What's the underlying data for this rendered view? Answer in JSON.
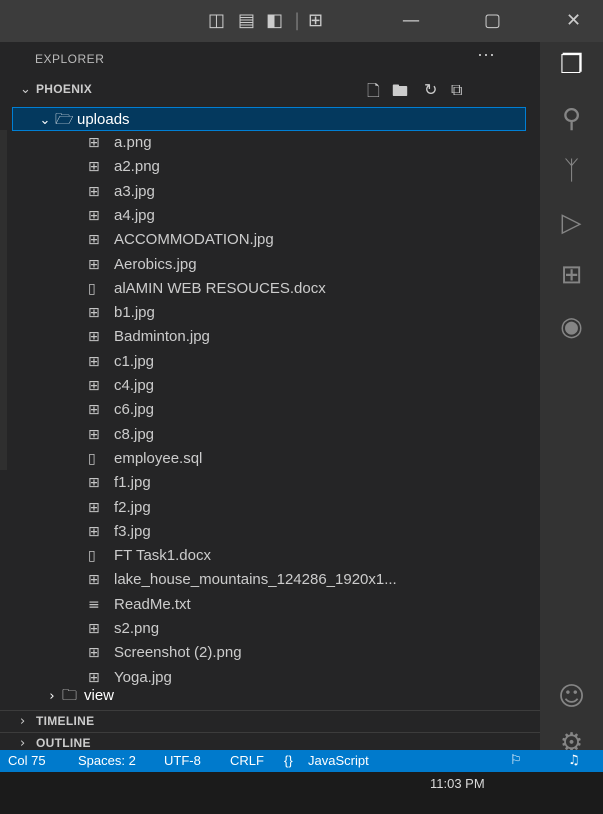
{
  "title_bar": {
    "layout_icons": [
      "▯▯",
      "▭",
      "▮▯",
      "⊞"
    ],
    "minimize": "—",
    "restore": "▢",
    "close": "✕"
  },
  "explorer": {
    "header": "EXPLORER",
    "more": "···",
    "project": "PHOENIX",
    "actions": [
      "new-file-icon",
      "new-folder-icon",
      "refresh-icon",
      "collapse-all-icon"
    ]
  },
  "tree": {
    "uploads": "uploads",
    "files": [
      {
        "name": "a.png",
        "icon": "image-file-icon"
      },
      {
        "name": "a2.png",
        "icon": "image-file-icon"
      },
      {
        "name": "a3.jpg",
        "icon": "image-file-icon"
      },
      {
        "name": "a4.jpg",
        "icon": "image-file-icon"
      },
      {
        "name": "ACCOMMODATION.jpg",
        "icon": "image-file-icon"
      },
      {
        "name": "Aerobics.jpg",
        "icon": "image-file-icon"
      },
      {
        "name": "alAMIN WEB RESOUCES.docx",
        "icon": "file-icon"
      },
      {
        "name": "b1.jpg",
        "icon": "image-file-icon"
      },
      {
        "name": "Badminton.jpg",
        "icon": "image-file-icon"
      },
      {
        "name": "c1.jpg",
        "icon": "image-file-icon"
      },
      {
        "name": "c4.jpg",
        "icon": "image-file-icon"
      },
      {
        "name": "c6.jpg",
        "icon": "image-file-icon"
      },
      {
        "name": "c8.jpg",
        "icon": "image-file-icon"
      },
      {
        "name": "employee.sql",
        "icon": "file-icon"
      },
      {
        "name": "f1.jpg",
        "icon": "image-file-icon"
      },
      {
        "name": "f2.jpg",
        "icon": "image-file-icon"
      },
      {
        "name": "f3.jpg",
        "icon": "image-file-icon"
      },
      {
        "name": "FT Task1.docx",
        "icon": "file-icon"
      },
      {
        "name": "lake_house_mountains_124286_1920x1...",
        "icon": "image-file-icon"
      },
      {
        "name": "ReadMe.txt",
        "icon": "text-file-icon"
      },
      {
        "name": "s2.png",
        "icon": "image-file-icon"
      },
      {
        "name": "Screenshot (2).png",
        "icon": "image-file-icon"
      },
      {
        "name": "Yoga.jpg",
        "icon": "image-file-icon"
      }
    ],
    "view": "view"
  },
  "sections": {
    "timeline": "TIMELINE",
    "outline": "OUTLINE"
  },
  "status_bar": {
    "cursor": "Col 75",
    "spaces": "Spaces: 2",
    "encoding": "UTF-8",
    "eol": "CRLF",
    "language_braces": "{}",
    "language": "JavaScript"
  },
  "taskbar": {
    "clock": "11:03 PM"
  }
}
